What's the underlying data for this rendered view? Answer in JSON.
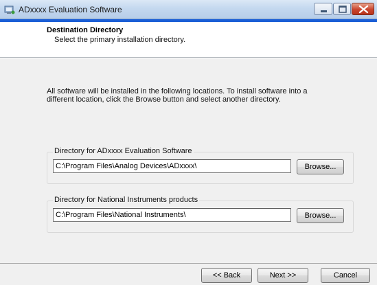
{
  "window": {
    "title": "ADxxxx Evaluation  Software",
    "icon": "installer-icon",
    "controls": [
      "minimize-icon",
      "maximize-icon",
      "close-icon"
    ]
  },
  "header": {
    "title": "Destination Directory",
    "subtitle": "Select the primary installation directory."
  },
  "body": {
    "description": "All software will be installed in the following locations. To install software into a different location, click the Browse button and select another directory.",
    "groups": [
      {
        "label": "Directory for ADxxxx Evaluation  Software",
        "path": "C:\\Program Files\\Analog Devices\\ADxxxx\\",
        "browse_label": "Browse..."
      },
      {
        "label": "Directory for National Instruments products",
        "path": "C:\\Program Files\\National Instruments\\",
        "browse_label": "Browse..."
      }
    ]
  },
  "footer": {
    "back_label": "<< Back",
    "next_label": "Next >>",
    "cancel_label": "Cancel"
  },
  "colors": {
    "accent": "#1a5ed6",
    "panel": "#f0f0f0",
    "close": "#c9452d"
  }
}
